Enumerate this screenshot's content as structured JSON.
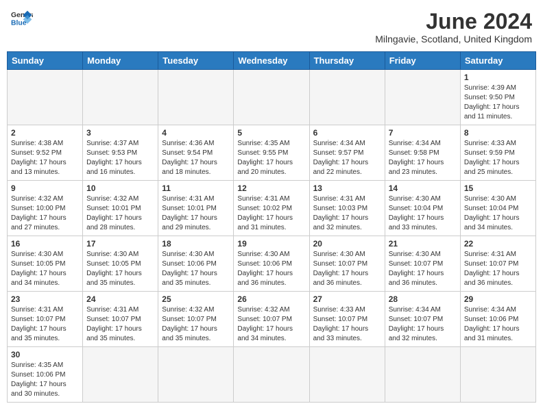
{
  "header": {
    "logo_general": "General",
    "logo_blue": "Blue",
    "month_title": "June 2024",
    "location": "Milngavie, Scotland, United Kingdom"
  },
  "weekdays": [
    "Sunday",
    "Monday",
    "Tuesday",
    "Wednesday",
    "Thursday",
    "Friday",
    "Saturday"
  ],
  "weeks": [
    [
      {
        "day": "",
        "empty": true
      },
      {
        "day": "",
        "empty": true
      },
      {
        "day": "",
        "empty": true
      },
      {
        "day": "",
        "empty": true
      },
      {
        "day": "",
        "empty": true
      },
      {
        "day": "",
        "empty": true
      },
      {
        "day": "1",
        "sunrise": "4:39 AM",
        "sunset": "9:50 PM",
        "daylight": "17 hours and 11 minutes."
      }
    ],
    [
      {
        "day": "2",
        "sunrise": "4:38 AM",
        "sunset": "9:52 PM",
        "daylight": "17 hours and 13 minutes."
      },
      {
        "day": "3",
        "sunrise": "4:37 AM",
        "sunset": "9:53 PM",
        "daylight": "17 hours and 16 minutes."
      },
      {
        "day": "4",
        "sunrise": "4:36 AM",
        "sunset": "9:54 PM",
        "daylight": "17 hours and 18 minutes."
      },
      {
        "day": "5",
        "sunrise": "4:35 AM",
        "sunset": "9:55 PM",
        "daylight": "17 hours and 20 minutes."
      },
      {
        "day": "6",
        "sunrise": "4:34 AM",
        "sunset": "9:57 PM",
        "daylight": "17 hours and 22 minutes."
      },
      {
        "day": "7",
        "sunrise": "4:34 AM",
        "sunset": "9:58 PM",
        "daylight": "17 hours and 23 minutes."
      },
      {
        "day": "8",
        "sunrise": "4:33 AM",
        "sunset": "9:59 PM",
        "daylight": "17 hours and 25 minutes."
      }
    ],
    [
      {
        "day": "9",
        "sunrise": "4:32 AM",
        "sunset": "10:00 PM",
        "daylight": "17 hours and 27 minutes."
      },
      {
        "day": "10",
        "sunrise": "4:32 AM",
        "sunset": "10:01 PM",
        "daylight": "17 hours and 28 minutes."
      },
      {
        "day": "11",
        "sunrise": "4:31 AM",
        "sunset": "10:01 PM",
        "daylight": "17 hours and 29 minutes."
      },
      {
        "day": "12",
        "sunrise": "4:31 AM",
        "sunset": "10:02 PM",
        "daylight": "17 hours and 31 minutes."
      },
      {
        "day": "13",
        "sunrise": "4:31 AM",
        "sunset": "10:03 PM",
        "daylight": "17 hours and 32 minutes."
      },
      {
        "day": "14",
        "sunrise": "4:30 AM",
        "sunset": "10:04 PM",
        "daylight": "17 hours and 33 minutes."
      },
      {
        "day": "15",
        "sunrise": "4:30 AM",
        "sunset": "10:04 PM",
        "daylight": "17 hours and 34 minutes."
      }
    ],
    [
      {
        "day": "16",
        "sunrise": "4:30 AM",
        "sunset": "10:05 PM",
        "daylight": "17 hours and 34 minutes."
      },
      {
        "day": "17",
        "sunrise": "4:30 AM",
        "sunset": "10:05 PM",
        "daylight": "17 hours and 35 minutes."
      },
      {
        "day": "18",
        "sunrise": "4:30 AM",
        "sunset": "10:06 PM",
        "daylight": "17 hours and 35 minutes."
      },
      {
        "day": "19",
        "sunrise": "4:30 AM",
        "sunset": "10:06 PM",
        "daylight": "17 hours and 36 minutes."
      },
      {
        "day": "20",
        "sunrise": "4:30 AM",
        "sunset": "10:07 PM",
        "daylight": "17 hours and 36 minutes."
      },
      {
        "day": "21",
        "sunrise": "4:30 AM",
        "sunset": "10:07 PM",
        "daylight": "17 hours and 36 minutes."
      },
      {
        "day": "22",
        "sunrise": "4:31 AM",
        "sunset": "10:07 PM",
        "daylight": "17 hours and 36 minutes."
      }
    ],
    [
      {
        "day": "23",
        "sunrise": "4:31 AM",
        "sunset": "10:07 PM",
        "daylight": "17 hours and 35 minutes."
      },
      {
        "day": "24",
        "sunrise": "4:31 AM",
        "sunset": "10:07 PM",
        "daylight": "17 hours and 35 minutes."
      },
      {
        "day": "25",
        "sunrise": "4:32 AM",
        "sunset": "10:07 PM",
        "daylight": "17 hours and 35 minutes."
      },
      {
        "day": "26",
        "sunrise": "4:32 AM",
        "sunset": "10:07 PM",
        "daylight": "17 hours and 34 minutes."
      },
      {
        "day": "27",
        "sunrise": "4:33 AM",
        "sunset": "10:07 PM",
        "daylight": "17 hours and 33 minutes."
      },
      {
        "day": "28",
        "sunrise": "4:34 AM",
        "sunset": "10:07 PM",
        "daylight": "17 hours and 32 minutes."
      },
      {
        "day": "29",
        "sunrise": "4:34 AM",
        "sunset": "10:06 PM",
        "daylight": "17 hours and 31 minutes."
      }
    ],
    [
      {
        "day": "30",
        "sunrise": "4:35 AM",
        "sunset": "10:06 PM",
        "daylight": "17 hours and 30 minutes."
      },
      {
        "day": "",
        "empty": true
      },
      {
        "day": "",
        "empty": true
      },
      {
        "day": "",
        "empty": true
      },
      {
        "day": "",
        "empty": true
      },
      {
        "day": "",
        "empty": true
      },
      {
        "day": "",
        "empty": true
      }
    ]
  ]
}
